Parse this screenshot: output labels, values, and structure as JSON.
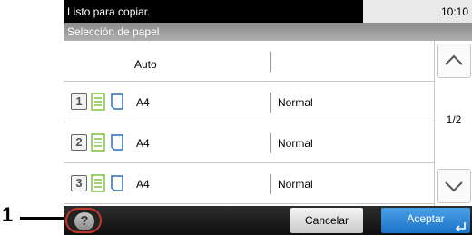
{
  "callout": {
    "number": "1"
  },
  "status": {
    "message": "Listo para copiar.",
    "time": "10:10"
  },
  "title": "Selección de papel",
  "auto_row": {
    "label": "Auto"
  },
  "rows": [
    {
      "cassette": "1",
      "size": "A4",
      "type": "Normal"
    },
    {
      "cassette": "2",
      "size": "A4",
      "type": "Normal"
    },
    {
      "cassette": "3",
      "size": "A4",
      "type": "Normal"
    }
  ],
  "scroll": {
    "page": "1/2",
    "up_icon": "chevron-up-icon",
    "down_icon": "chevron-down-icon"
  },
  "footer": {
    "help_label": "?",
    "cancel_label": "Cancelar",
    "accept_label": "Aceptar",
    "enter_icon": "enter-icon"
  },
  "colors": {
    "accent_green": "#7dc242",
    "accept_blue": "#2a86d8",
    "help_outline": "#c0392b"
  }
}
